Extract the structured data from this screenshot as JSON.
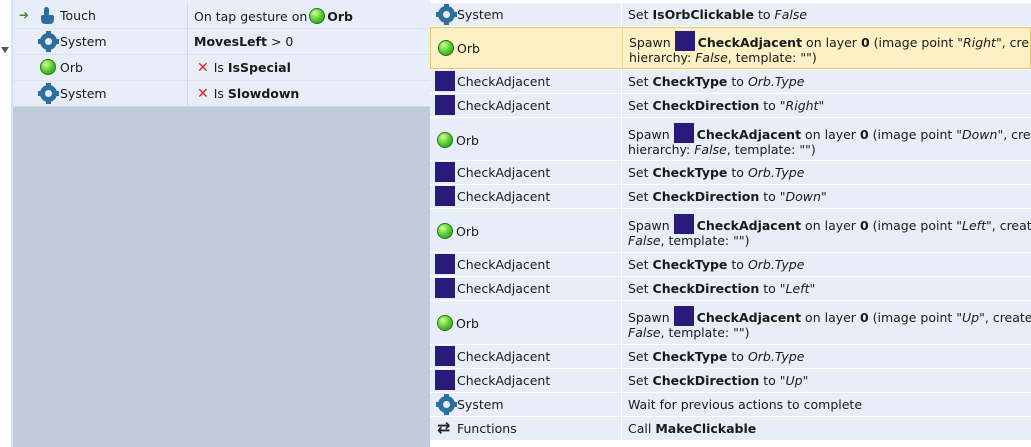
{
  "event": {
    "conditions": [
      {
        "object": "Touch",
        "icon": "touch-icon",
        "pre": "On tap gesture on",
        "obj_ref": "Orb",
        "obj_ref_icon": "orb-icon",
        "triggered": true
      },
      {
        "object": "System",
        "icon": "gear-icon",
        "bold": "MovesLeft",
        "rest": "> 0"
      },
      {
        "object": "Orb",
        "icon": "orb-icon",
        "inverted": true,
        "is": "Is",
        "bold": "IsSpecial"
      },
      {
        "object": "System",
        "icon": "gear-icon",
        "inverted": true,
        "is": "Is",
        "bold": "Slowdown"
      }
    ]
  },
  "actions": [
    {
      "object": "System",
      "icon": "gear-icon",
      "verb": "Set",
      "name": "IsOrbClickable",
      "to": "to",
      "value": "False"
    },
    {
      "object": "Orb",
      "icon": "orb-icon",
      "selected": true,
      "spawn": "Spawn",
      "spawned": "CheckAdjacent",
      "l1_mid": "on layer",
      "layer": "0",
      "l1_ip": "(image point",
      "point": "\"Right\"",
      "l1_tail": ", create",
      "l2_head": "hierarchy:",
      "hierarchy": "False",
      "l2_tail": ", template: \"\")"
    },
    {
      "object": "CheckAdjacent",
      "icon": "square-icon",
      "verb": "Set",
      "name": "CheckType",
      "to": "to",
      "value": "Orb.Type"
    },
    {
      "object": "CheckAdjacent",
      "icon": "square-icon",
      "verb": "Set",
      "name": "CheckDirection",
      "to": "to",
      "value": "\"Right\""
    },
    {
      "object": "Orb",
      "icon": "orb-icon",
      "spawn": "Spawn",
      "spawned": "CheckAdjacent",
      "l1_mid": "on layer",
      "layer": "0",
      "l1_ip": "(image point",
      "point": "\"Down\"",
      "l1_tail": ", create",
      "l2_head": "hierarchy:",
      "hierarchy": "False",
      "l2_tail": ", template: \"\")"
    },
    {
      "object": "CheckAdjacent",
      "icon": "square-icon",
      "verb": "Set",
      "name": "CheckType",
      "to": "to",
      "value": "Orb.Type"
    },
    {
      "object": "CheckAdjacent",
      "icon": "square-icon",
      "verb": "Set",
      "name": "CheckDirection",
      "to": "to",
      "value": "\"Down\""
    },
    {
      "object": "Orb",
      "icon": "orb-icon",
      "spawn": "Spawn",
      "spawned": "CheckAdjacent",
      "l1_mid": "on layer",
      "layer": "0",
      "l1_ip": "(image point",
      "point": "\"Left\"",
      "l1_tail": ", create hierar",
      "l2_head": "",
      "hierarchy": "False",
      "l2_tail": ", template: \"\")"
    },
    {
      "object": "CheckAdjacent",
      "icon": "square-icon",
      "verb": "Set",
      "name": "CheckType",
      "to": "to",
      "value": "Orb.Type"
    },
    {
      "object": "CheckAdjacent",
      "icon": "square-icon",
      "verb": "Set",
      "name": "CheckDirection",
      "to": "to",
      "value": "\"Left\""
    },
    {
      "object": "Orb",
      "icon": "orb-icon",
      "spawn": "Spawn",
      "spawned": "CheckAdjacent",
      "l1_mid": "on layer",
      "layer": "0",
      "l1_ip": "(image point",
      "point": "\"Up\"",
      "l1_tail": ", create hierarc",
      "l2_head": "",
      "hierarchy": "False",
      "l2_tail": ", template: \"\")"
    },
    {
      "object": "CheckAdjacent",
      "icon": "square-icon",
      "verb": "Set",
      "name": "CheckType",
      "to": "to",
      "value": "Orb.Type"
    },
    {
      "object": "CheckAdjacent",
      "icon": "square-icon",
      "verb": "Set",
      "name": "CheckDirection",
      "to": "to",
      "value": "\"Up\""
    },
    {
      "object": "System",
      "icon": "gear-icon",
      "plain": "Wait for previous actions to complete"
    },
    {
      "object": "Functions",
      "icon": "functions-icon",
      "verb": "Call",
      "name": "MakeClickable"
    }
  ],
  "colors": {
    "condition_bg": "#e8eef8",
    "empty_event_area": "#c0ccdc",
    "action_bg": "#e8eef8",
    "selected_bg": "#fbf1c4",
    "sprite_square": "#2a1a7a",
    "invert_cross": "#d42020"
  }
}
